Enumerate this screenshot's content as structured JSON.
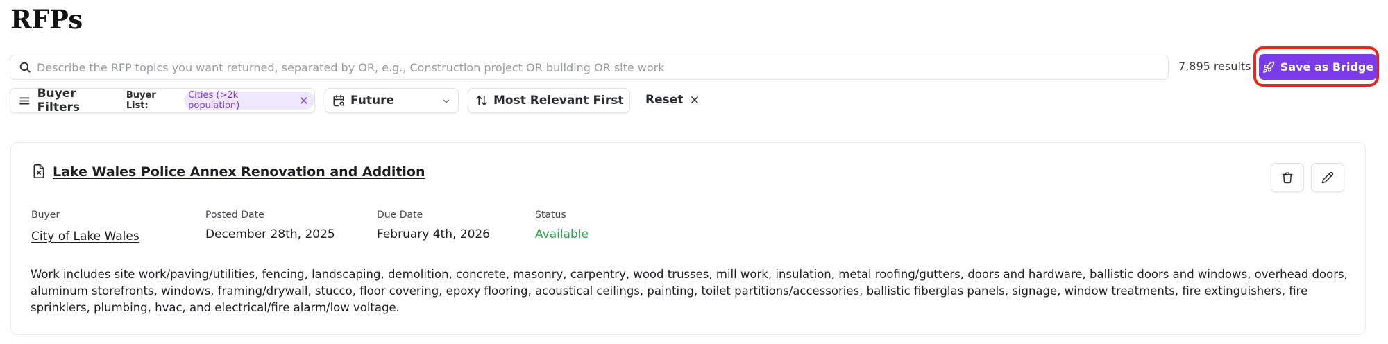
{
  "page": {
    "title": "RFPs"
  },
  "search": {
    "placeholder": "Describe the RFP topics you want returned, separated by OR, e.g., Construction project OR building OR site work",
    "value": "",
    "results_count": "7,895 results"
  },
  "actions": {
    "save_bridge_label": "Save as Bridge"
  },
  "filters": {
    "buyer_filters_label": "Buyer Filters",
    "buyer_list_label": "Buyer List:",
    "buyer_list_chip": "Cities (>2k population)",
    "timeframe_label": "Future",
    "sort_label": "Most Relevant First",
    "reset_label": "Reset"
  },
  "rfp": {
    "title": "Lake Wales Police Annex Renovation and Addition",
    "fields": {
      "buyer_label": "Buyer",
      "buyer_value": "City of Lake Wales",
      "posted_label": "Posted Date",
      "posted_value": "December 28th, 2025",
      "due_label": "Due Date",
      "due_value": "February 4th, 2026",
      "status_label": "Status",
      "status_value": "Available"
    },
    "description": "Work includes site work/paving/utilities, fencing, landscaping, demolition, concrete, masonry, carpentry, wood trusses, mill work, insulation, metal roofing/gutters, doors and hardware, ballistic doors and windows, overhead doors, aluminum storefronts, windows, framing/drywall, stucco, floor covering, epoxy flooring, acoustical ceilings, painting, toilet partitions/accessories, ballistic fiberglas panels, signage, window treatments, fire extinguishers, fire sprinklers, plumbing, hvac, and electrical/fire alarm/low voltage."
  },
  "colors": {
    "accent": "#7b3be8",
    "chip_bg": "#efe7fd",
    "status_available": "#2ea44f",
    "highlight": "#e8261c"
  },
  "icons": [
    "search-icon",
    "rocket-icon",
    "menu-lines-icon",
    "close-icon",
    "calendar-search-icon",
    "chevron-down-icon",
    "sort-arrows-icon",
    "document-x-icon",
    "trash-icon",
    "pencil-icon"
  ]
}
